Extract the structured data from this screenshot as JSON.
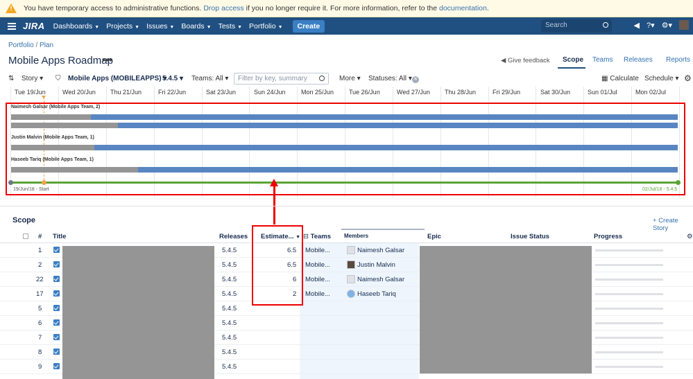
{
  "banner": {
    "text_before": "You have temporary access to administrative functions. ",
    "link_drop": "Drop access",
    "text_middle": " if you no longer require it. For more information, refer to the ",
    "link_docs": "documentation",
    "text_after": "."
  },
  "nav": {
    "logo": "JIRA",
    "items": [
      "Dashboards",
      "Projects",
      "Issues",
      "Boards",
      "Tests",
      "Portfolio"
    ],
    "create": "Create",
    "search_placeholder": "Search"
  },
  "breadcrumb": {
    "first": "Portfolio",
    "sep": " / ",
    "second": "Plan"
  },
  "page": {
    "title": "Mobile Apps Roadmap",
    "more": "•••",
    "feedback": "Give feedback"
  },
  "tabs": [
    "Scope",
    "Teams",
    "Releases",
    "Reports"
  ],
  "toolbar": {
    "story": "Story",
    "project": "Mobile Apps (MOBILEAPPS)",
    "release": "5.4.5",
    "teams": "Teams: All",
    "filter_placeholder": "Filter by key, summary",
    "more": "More",
    "statuses": "Statuses: All",
    "calculate": "Calculate",
    "schedule": "Schedule"
  },
  "timeline": {
    "days": [
      "Tue 19/Jun",
      "Wed 20/Jun",
      "Thu 21/Jun",
      "Fri 22/Jun",
      "Sat 23/Jun",
      "Sun 24/Jun",
      "Mon 25/Jun",
      "Tue 26/Jun",
      "Wed 27/Jun",
      "Thu 28/Jun",
      "Fri 29/Jun",
      "Sat 30/Jun",
      "Sun 01/Jul",
      "Mon 02/Jul"
    ],
    "people": [
      {
        "label": "Naimesh Galsar (Mobile Apps Team, 2)",
        "bars_done": [
          0.12,
          0.16
        ]
      },
      {
        "label": "Justin Malvin (Mobile Apps Team, 1)",
        "bars_done": [
          0.125
        ]
      },
      {
        "label": "Haseeb Tariq (Mobile Apps Team, 1)",
        "bars_done": [
          0.19
        ]
      }
    ],
    "start_label": "19/Jun/18 - Start",
    "end_label": "02/Jul/18 - 5.4.5"
  },
  "scope": {
    "title": "Scope",
    "create_story": "+ Create Story",
    "headers": [
      "#",
      "Title",
      "Releases",
      "Estimate...",
      "Teams",
      "Members",
      "Epic",
      "Issue Status",
      "Progress"
    ],
    "rows": [
      {
        "num": "1",
        "release": "5.4.5",
        "estimate": "6.5",
        "team": "Mobile...",
        "member": "Naimesh Galsar"
      },
      {
        "num": "2",
        "release": "5.4.5",
        "estimate": "6.5",
        "team": "Mobile...",
        "member": "Justin Malvin"
      },
      {
        "num": "22",
        "release": "5.4.5",
        "estimate": "6",
        "team": "Mobile...",
        "member": "Naimesh Galsar"
      },
      {
        "num": "17",
        "release": "5.4.5",
        "estimate": "2",
        "team": "Mobile...",
        "member": "Haseeb Tariq"
      },
      {
        "num": "5",
        "release": "5.4.5",
        "estimate": "",
        "team": "",
        "member": ""
      },
      {
        "num": "6",
        "release": "5.4.5",
        "estimate": "",
        "team": "",
        "member": ""
      },
      {
        "num": "7",
        "release": "5.4.5",
        "estimate": "",
        "team": "",
        "member": ""
      },
      {
        "num": "8",
        "release": "5.4.5",
        "estimate": "",
        "team": "",
        "member": ""
      },
      {
        "num": "9",
        "release": "5.4.5",
        "estimate": "",
        "team": "",
        "member": ""
      }
    ]
  },
  "colors": {
    "nav": "#205081",
    "bar": "#5986c2",
    "bar_done": "#959595",
    "release_line": "#5aa433",
    "annotation": "#e00000"
  }
}
